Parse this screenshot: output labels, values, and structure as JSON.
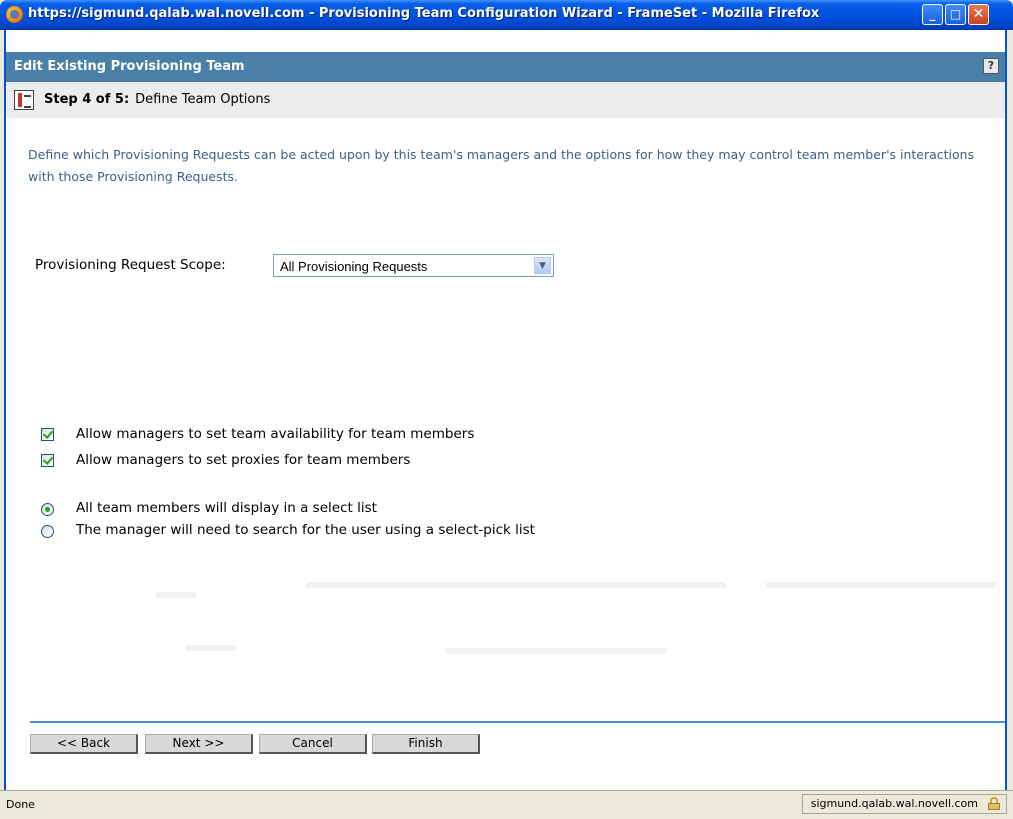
{
  "window": {
    "title": "https://sigmund.qalab.wal.novell.com - Provisioning Team Configuration Wizard - FrameSet - Mozilla Firefox",
    "minimize_label": "_",
    "maximize_label": "□",
    "close_label": "✕"
  },
  "header": {
    "title": "Edit Existing Provisioning Team",
    "help_label": "?"
  },
  "step": {
    "number_label": "Step 4 of 5:",
    "name": "Define Team Options"
  },
  "intro": "Define which Provisioning Requests can be acted upon by this team's managers and the options for how they may control team member's interactions with those Provisioning Requests.",
  "scope": {
    "label": "Provisioning Request Scope:",
    "selected": "All Provisioning Requests"
  },
  "checkboxes": [
    {
      "label": "Allow managers to set team availability for team members",
      "checked": true
    },
    {
      "label": "Allow managers to set proxies for team members",
      "checked": true
    }
  ],
  "radios": [
    {
      "label": "All team members will display in a select list",
      "selected": true
    },
    {
      "label": "The manager will need to search for the user using a select-pick list",
      "selected": false
    }
  ],
  "buttons": {
    "back": "<< Back",
    "next": "Next >>",
    "cancel": "Cancel",
    "finish": "Finish"
  },
  "status": {
    "text": "Done",
    "host": "sigmund.qalab.wal.novell.com"
  },
  "colors": {
    "header_bar": "#4a7fa8",
    "intro_text": "#3b5f8a",
    "divider": "#4a8fcf",
    "check_green": "#21a121"
  }
}
